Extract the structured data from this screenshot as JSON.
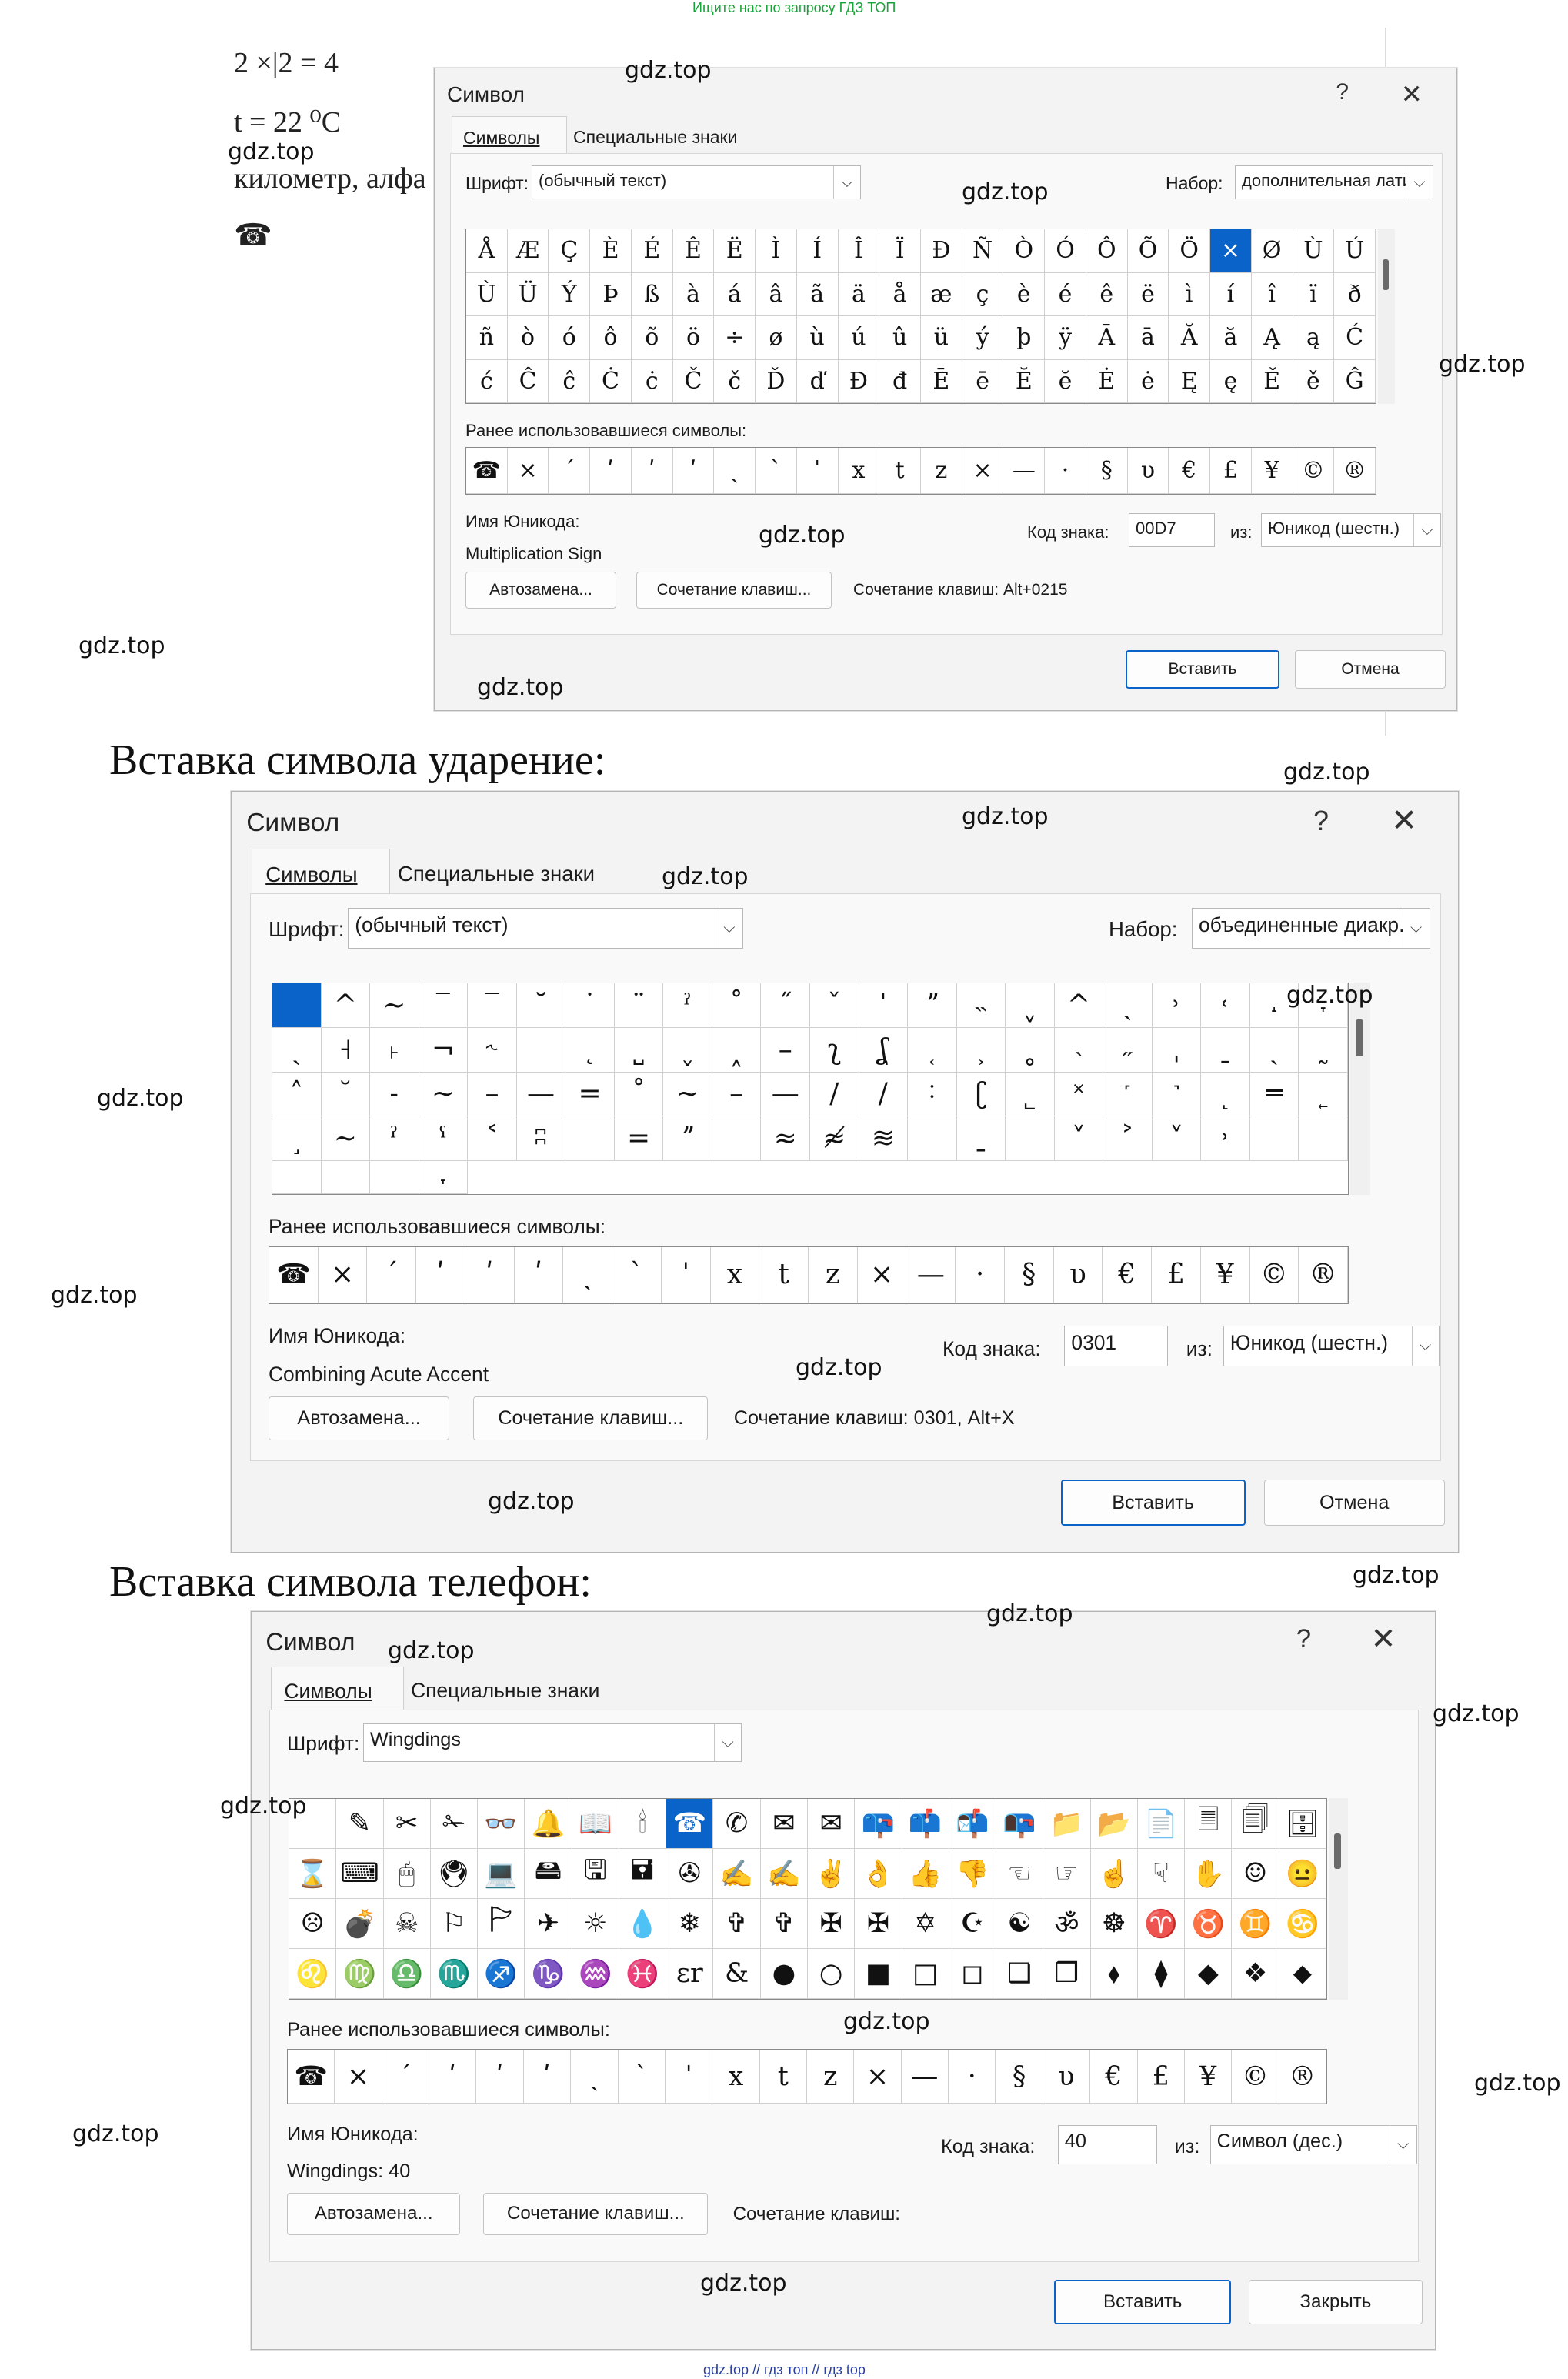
{
  "top_note": "Ищите нас по запросу ГДЗ ТОП",
  "footer": "gdz.top // гдз топ // гдз top",
  "watermark": "gdz.top",
  "doc_snippet": {
    "line1": "2 ×|2 = 4",
    "line2": "t = 22 ⁰C",
    "line3": "километр, алфа",
    "phone": "☎"
  },
  "headings": {
    "accent": "Вставка символа ударение:",
    "phone": "Вставка символа телефон:"
  },
  "dialogs": [
    {
      "title": "Символ",
      "help": "?",
      "close": "✕",
      "tabs": [
        "Символы",
        "Специальные знаки"
      ],
      "font_label": "Шрифт:",
      "font_value": "(обычный текст)",
      "set_label": "Набор:",
      "set_value": "дополнительная латин",
      "symbols": [
        "Å",
        "Æ",
        "Ç",
        "È",
        "É",
        "Ê",
        "Ë",
        "Ì",
        "Í",
        "Î",
        "Ï",
        "Ð",
        "Ñ",
        "Ò",
        "Ó",
        "Ô",
        "Õ",
        "Ö",
        "×",
        "Ø",
        "Ù",
        "Ú",
        "Ù",
        "Ü",
        "Ý",
        "Þ",
        "ß",
        "à",
        "á",
        "â",
        "ã",
        "ä",
        "å",
        "æ",
        "ç",
        "è",
        "é",
        "ê",
        "ë",
        "ì",
        "í",
        "î",
        "ï",
        "ð",
        "ñ",
        "ò",
        "ó",
        "ô",
        "õ",
        "ö",
        "÷",
        "ø",
        "ù",
        "ú",
        "û",
        "ü",
        "ý",
        "þ",
        "ÿ",
        "Ā",
        "ā",
        "Ă",
        "ă",
        "Ą",
        "ą",
        "Ć",
        "ć",
        "Ĉ",
        "ĉ",
        "Ċ",
        "ċ",
        "Č",
        "č",
        "Ď",
        "ď",
        "Đ",
        "đ",
        "Ē",
        "ē",
        "Ĕ",
        "ĕ",
        "Ė",
        "ė",
        "Ę",
        "ę",
        "Ě",
        "ě",
        "Ĝ"
      ],
      "selected_index": 18,
      "recent_label": "Ранее использовавшиеся символы:",
      "recent": [
        "☎",
        "×",
        "ˊ",
        "ʹ",
        "ʹ",
        "ʹ",
        "ˏ",
        "ˋ",
        "ˈ",
        "x",
        "t",
        "z",
        "×",
        "—",
        "·",
        "§",
        "υ",
        "€",
        "£",
        "¥",
        "©",
        "®"
      ],
      "unicode_name_label": "Имя Юникода:",
      "unicode_name": "Multiplication Sign",
      "code_label": "Код знака:",
      "code_value": "00D7",
      "from_label": "из:",
      "from_value": "Юникод (шестн.)",
      "autocorrect": "Автозамена...",
      "shortcut_btn": "Сочетание клавиш...",
      "shortcut_text": "Сочетание клавиш: Alt+0215",
      "insert": "Вставить",
      "cancel": "Отмена"
    },
    {
      "title": "Символ",
      "help": "?",
      "close": "✕",
      "tabs": [
        "Символы",
        "Специальные знаки"
      ],
      "font_label": "Шрифт:",
      "font_value": "(обычный текст)",
      "set_label": "Набор:",
      "set_value": "объединенные диакр.",
      "symbols": [
        "",
        "^",
        "~",
        "‾",
        "‾",
        "˘",
        "˙",
        "¨",
        "ˀ",
        "˚",
        "˝",
        "ˇ",
        "ˈ",
        "ˮ",
        "˵",
        "ˬ",
        "^",
        "ˏ",
        "˒",
        "˓",
        "˔",
        "˕",
        "ˏ",
        "˧",
        "˫",
        "¬",
        "˞",
        "",
        "˛",
        "˽",
        "˯",
        "˰",
        "–",
        "ʅ",
        "ʆ",
        "˱",
        "˲",
        "˳",
        "˴",
        "˶",
        "ˌ",
        "ˍ",
        "ˎ",
        "˷",
        "˄",
        "˘",
        "˗",
        "∼",
        "–",
        "—",
        "=",
        "˚",
        "~",
        "–",
        "—",
        "∕",
        "/",
        "˸",
        "ʗ",
        "˾",
        "˟",
        "˹",
        "˺",
        "˻",
        "═",
        "˿",
        "˼",
        "∼",
        "ˀ",
        "ˁ",
        "˂",
        "ʭ",
        "",
        "=",
        "ˮ",
        "",
        "≈",
        "≉",
        "≋",
        "",
        "ˍ",
        "",
        "˅",
        "˃",
        "˅",
        "˒",
        "",
        "",
        "",
        "",
        "",
        "˕"
      ],
      "selected_index": 0,
      "recent_label": "Ранее использовавшиеся символы:",
      "recent": [
        "☎",
        "×",
        "ˊ",
        "ʹ",
        "ʹ",
        "ʹ",
        "ˏ",
        "ˋ",
        "ˈ",
        "x",
        "t",
        "z",
        "×",
        "—",
        "·",
        "§",
        "υ",
        "€",
        "£",
        "¥",
        "©",
        "®"
      ],
      "unicode_name_label": "Имя Юникода:",
      "unicode_name": "Combining Acute Accent",
      "code_label": "Код знака:",
      "code_value": "0301",
      "from_label": "из:",
      "from_value": "Юникод (шестн.)",
      "autocorrect": "Автозамена...",
      "shortcut_btn": "Сочетание клавиш...",
      "shortcut_text": "Сочетание клавиш: 0301, Alt+X",
      "insert": "Вставить",
      "cancel": "Отмена"
    },
    {
      "title": "Символ",
      "help": "?",
      "close": "✕",
      "tabs": [
        "Символы",
        "Специальные знаки"
      ],
      "font_label": "Шрифт:",
      "font_value": "Wingdings",
      "set_label": "",
      "set_value": "",
      "symbols": [
        "",
        "✎",
        "✂",
        "✁",
        "👓",
        "🔔",
        "📖",
        "🕯",
        "☎",
        "✆",
        "✉",
        "✉",
        "📪",
        "📫",
        "📬",
        "📭",
        "📁",
        "📂",
        "📄",
        "🗏",
        "🗐",
        "🗄",
        "⌛",
        "⌨",
        "🖱",
        "🖲",
        "💻",
        "🖴",
        "🖫",
        "🖬",
        "✇",
        "✍",
        "✍",
        "✌",
        "👌",
        "👍",
        "👎",
        "☜",
        "☞",
        "☝",
        "☟",
        "✋",
        "☺",
        "😐",
        "☹",
        "💣",
        "☠",
        "⚐",
        "🏱",
        "✈",
        "☼",
        "💧",
        "❄",
        "✞",
        "✞",
        "✠",
        "✠",
        "✡",
        "☪",
        "☯",
        "ॐ",
        "☸",
        "♈",
        "♉",
        "♊",
        "♋",
        "♌",
        "♍",
        "♎",
        "♏",
        "♐",
        "♑",
        "♒",
        "♓",
        "ɛr",
        "&",
        "●",
        "○",
        "■",
        "□",
        "◻",
        "❑",
        "❒",
        "⬧",
        "⧫",
        "◆",
        "❖",
        "⬥"
      ],
      "selected_index": 8,
      "recent_label": "Ранее использовавшиеся символы:",
      "recent": [
        "☎",
        "×",
        "ˊ",
        "ʹ",
        "ʹ",
        "ʹ",
        "ˏ",
        "ˋ",
        "ˈ",
        "x",
        "t",
        "z",
        "×",
        "—",
        "·",
        "§",
        "υ",
        "€",
        "£",
        "¥",
        "©",
        "®"
      ],
      "unicode_name_label": "Имя Юникода:",
      "unicode_name": "Wingdings: 40",
      "code_label": "Код знака:",
      "code_value": "40",
      "from_label": "из:",
      "from_value": "Символ (дес.)",
      "autocorrect": "Автозамена...",
      "shortcut_btn": "Сочетание клавиш...",
      "shortcut_text": "Сочетание клавиш:",
      "insert": "Вставить",
      "cancel": "Закрыть"
    }
  ]
}
